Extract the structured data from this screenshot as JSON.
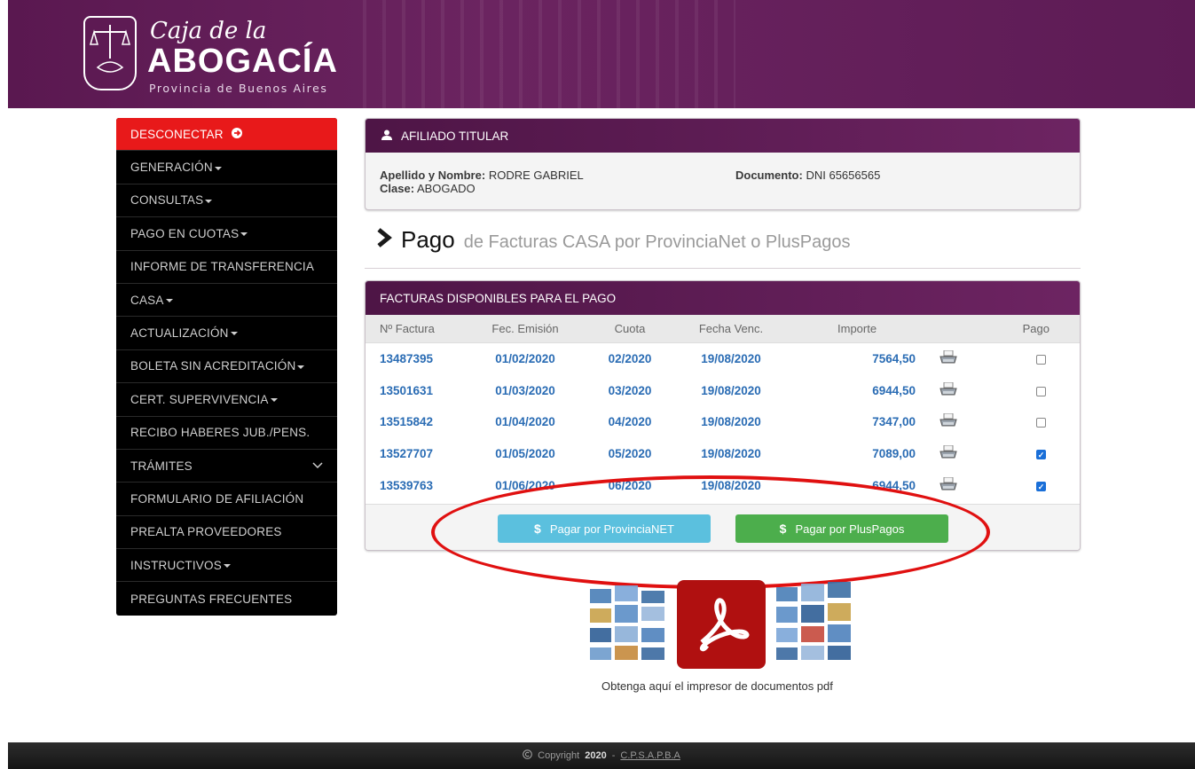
{
  "header": {
    "logo_script": "Caja de la",
    "logo_main": "ABOGACÍA",
    "logo_sub": "Provincia de Buenos Aires"
  },
  "sidebar": {
    "items": [
      {
        "label": "DESCONECTAR",
        "icon": "logout-icon"
      },
      {
        "label": "GENERACIÓN"
      },
      {
        "label": "CONSULTAS"
      },
      {
        "label": "PAGO EN CUOTAS"
      },
      {
        "label": "INFORME DE TRANSFERENCIA"
      },
      {
        "label": "CASA"
      },
      {
        "label": "ACTUALIZACIÓN"
      },
      {
        "label": "BOLETA SIN ACREDITACIÓN"
      },
      {
        "label": "CERT. SUPERVIVENCIA"
      },
      {
        "label": "RECIBO HABERES JUB./PENS."
      },
      {
        "label": "TRÁMITES"
      },
      {
        "label": "FORMULARIO DE AFILIACIÓN"
      },
      {
        "label": "PREALTA PROVEEDORES"
      },
      {
        "label": "INSTRUCTIVOS"
      },
      {
        "label": "PREGUNTAS FRECUENTES"
      }
    ]
  },
  "afiliado": {
    "title": "AFILIADO TITULAR",
    "name_label": "Apellido y Nombre:",
    "name_value": "RODRE  GABRIEL",
    "clase_label": "Clase:",
    "clase_value": "ABOGADO",
    "doc_label": "Documento:",
    "doc_value": "DNI 65656565"
  },
  "page_title": {
    "main": "Pago",
    "sub": "de Facturas CASA por ProvinciaNet o PlusPagos"
  },
  "facturas": {
    "title": "FACTURAS DISPONIBLES PARA EL PAGO",
    "columns": [
      "Nº Factura",
      "Fec. Emisión",
      "Cuota",
      "Fecha Venc.",
      "Importe",
      "",
      "Pago"
    ],
    "rows": [
      {
        "nro": "13487395",
        "emision": "01/02/2020",
        "cuota": "02/2020",
        "venc": "19/08/2020",
        "importe": "7564,50",
        "checked": false
      },
      {
        "nro": "13501631",
        "emision": "01/03/2020",
        "cuota": "03/2020",
        "venc": "19/08/2020",
        "importe": "6944,50",
        "checked": false
      },
      {
        "nro": "13515842",
        "emision": "01/04/2020",
        "cuota": "04/2020",
        "venc": "19/08/2020",
        "importe": "7347,00",
        "checked": false
      },
      {
        "nro": "13527707",
        "emision": "01/05/2020",
        "cuota": "05/2020",
        "venc": "19/08/2020",
        "importe": "7089,00",
        "checked": true
      },
      {
        "nro": "13539763",
        "emision": "01/06/2020",
        "cuota": "06/2020",
        "venc": "19/08/2020",
        "importe": "6944,50",
        "checked": true
      }
    ],
    "btn_provincia": "Pagar por ProvinciaNET",
    "btn_plus": "Pagar por PlusPagos"
  },
  "pdf": {
    "caption": "Obtenga aquí el impresor de documentos pdf"
  },
  "footer": {
    "copyright": "Copyright",
    "year": "2020",
    "dash": "-",
    "org": "C.P.S.A.P.B.A"
  },
  "colors": {
    "brand_purple": "#5a1850",
    "logout_red": "#e8191a",
    "link_blue": "#2a6cb4",
    "btn_info": "#5bc0de",
    "btn_success": "#4cae4c",
    "highlight_red": "#e01010"
  }
}
